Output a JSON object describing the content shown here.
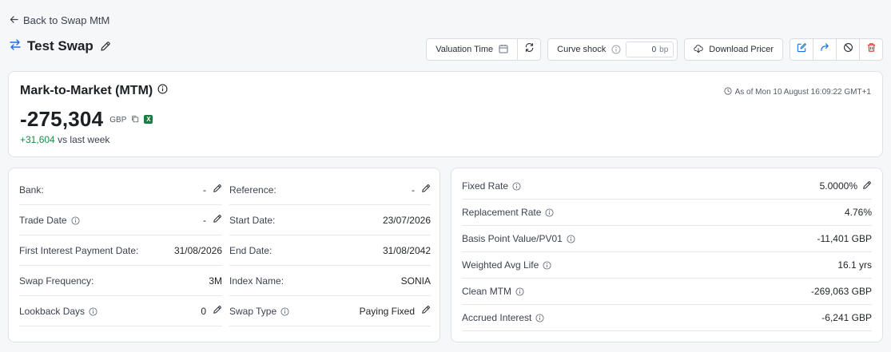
{
  "nav": {
    "back_label": "Back to Swap MtM"
  },
  "header": {
    "title": "Test Swap"
  },
  "toolbar": {
    "valuation_time_label": "Valuation Time",
    "curve_shock_label": "Curve shock",
    "curve_shock_value": "0",
    "curve_shock_unit": "bp",
    "download_label": "Download Pricer"
  },
  "mtm": {
    "title": "Mark-to-Market (MTM)",
    "as_of": "As of Mon 10 August 16:09:22 GMT+1",
    "value": "-275,304",
    "currency": "GBP",
    "excel_label": "X",
    "change_value": "+31,604",
    "change_suffix": "vs last week"
  },
  "details": {
    "left": [
      {
        "label": "Bank:",
        "value": "-",
        "editable": true,
        "info": false
      },
      {
        "label": "Trade Date",
        "value": "-",
        "editable": true,
        "info": true
      },
      {
        "label": "First Interest Payment Date:",
        "value": "31/08/2026",
        "editable": false,
        "info": false
      },
      {
        "label": "Swap Frequency:",
        "value": "3M",
        "editable": false,
        "info": false
      },
      {
        "label": "Lookback Days",
        "value": "0",
        "editable": true,
        "info": true
      }
    ],
    "right": [
      {
        "label": "Reference:",
        "value": "-",
        "editable": true,
        "info": false
      },
      {
        "label": "Start Date:",
        "value": "23/07/2026",
        "editable": false,
        "info": false
      },
      {
        "label": "End Date:",
        "value": "31/08/2042",
        "editable": false,
        "info": false
      },
      {
        "label": "Index Name:",
        "value": "SONIA",
        "editable": false,
        "info": false
      },
      {
        "label": "Swap Type",
        "value": "Paying Fixed",
        "editable": true,
        "info": true
      }
    ]
  },
  "metrics": [
    {
      "label": "Fixed Rate",
      "value": "5.0000%",
      "editable": true
    },
    {
      "label": "Replacement Rate",
      "value": "4.76%",
      "editable": false
    },
    {
      "label": "Basis Point Value/PV01",
      "value": "-11,401 GBP",
      "editable": false
    },
    {
      "label": "Weighted Avg Life",
      "value": "16.1 yrs",
      "editable": false
    },
    {
      "label": "Clean MTM",
      "value": "-269,063 GBP",
      "editable": false
    },
    {
      "label": "Accrued Interest",
      "value": "-6,241 GBP",
      "editable": false
    }
  ],
  "colors": {
    "positive": "#1a8a48",
    "delete": "#d93025",
    "accent": "#1f6feb"
  }
}
